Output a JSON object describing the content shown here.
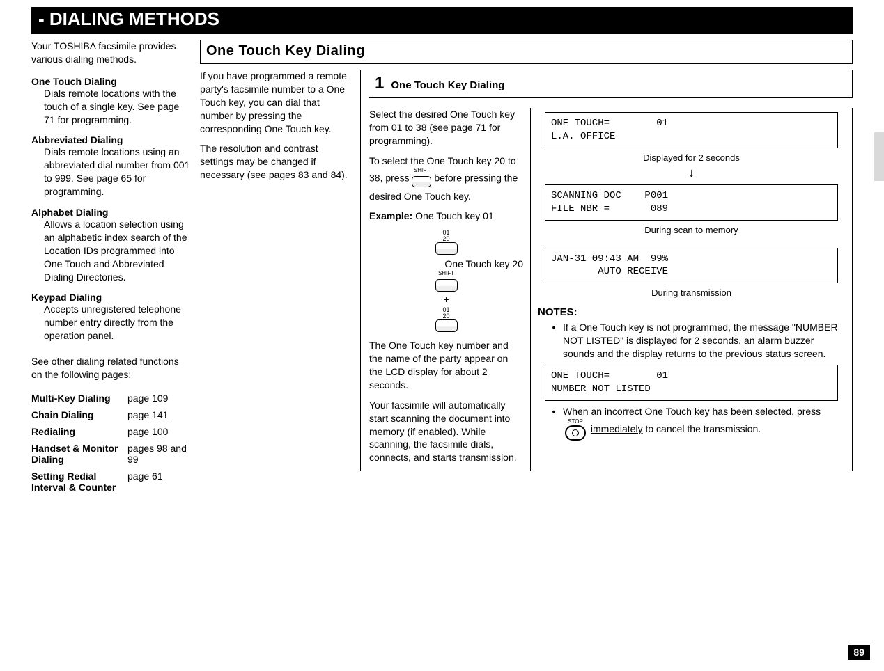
{
  "titleBar": "- DIALING METHODS",
  "intro": "Your TOSHIBA facsimile provides various dialing methods.",
  "methods": [
    {
      "title": "One Touch Dialing",
      "desc": "Dials remote locations with the touch of a single key. See page 71 for programming."
    },
    {
      "title": "Abbreviated Dialing",
      "desc": "Dials remote locations using an abbreviated dial number from 001 to 999. See page 65 for programming."
    },
    {
      "title": "Alphabet Dialing",
      "desc": "Allows a location selection using an alphabetic index search of the Location IDs programmed into One Touch and Abbreviated Dialing Directories."
    },
    {
      "title": "Keypad Dialing",
      "desc": "Accepts unregistered telephone number entry directly from the operation panel."
    }
  ],
  "seeOther": "See other dialing related functions on the following pages:",
  "refs": [
    {
      "name": "Multi-Key Dialing",
      "page": "page 109"
    },
    {
      "name": "Chain Dialing",
      "page": "page 141"
    },
    {
      "name": "Redialing",
      "page": "page 100"
    },
    {
      "name": "Handset & Monitor Dialing",
      "page": "pages 98 and 99"
    },
    {
      "name": "Setting Redial Interval & Counter",
      "page": "page 61"
    }
  ],
  "sectionHead": "One Touch Key Dialing",
  "midPara1": "If you have programmed a remote party's facsimile number to a One Touch key, you can dial that number by pressing the corresponding One Touch key.",
  "midPara2": "The resolution and contrast settings may be changed if necessary (see pages 83 and 84).",
  "step": {
    "num": "1",
    "title": "One Touch Key Dialing",
    "left": {
      "p1": "Select the desired One Touch key from 01 to 38 (see page 71 for programming).",
      "p2a": "To select the One Touch key 20 to 38, press ",
      "p2b": " before pressing the desired One Touch key.",
      "exampleLabel": "Example:",
      "exampleText": " One Touch key 01",
      "key20Label": "One Touch key 20",
      "p3": "The One Touch key number and the name of the party appear on the LCD display for about 2 seconds.",
      "p4": "Your facsimile will automatically start scanning the document into memory (if enabled). While scanning, the facsimile dials, connects, and starts transmission."
    },
    "right": {
      "lcd1": "ONE TOUCH=        01\nL.A. OFFICE",
      "cap1": "Displayed for 2 seconds",
      "lcd2": "SCANNING DOC    P001\nFILE NBR =       089",
      "cap2": "During scan to memory",
      "lcd3": "JAN-31 09:43 AM  99%\n        AUTO RECEIVE",
      "cap3": "During transmission",
      "notesHead": "NOTES:",
      "note1": "If a One Touch key is not programmed, the message \"NUMBER NOT LISTED\" is displayed for 2 seconds, an alarm buzzer sounds and the display returns to the previous status screen.",
      "lcd4": "ONE TOUCH=        01\nNUMBER NOT LISTED",
      "note2a": "When an incorrect One Touch key has been selected, press ",
      "note2b": " immediately",
      "note2c": " to cancel the transmission.",
      "stopLabel": "STOP"
    }
  },
  "pageNumber": "89"
}
